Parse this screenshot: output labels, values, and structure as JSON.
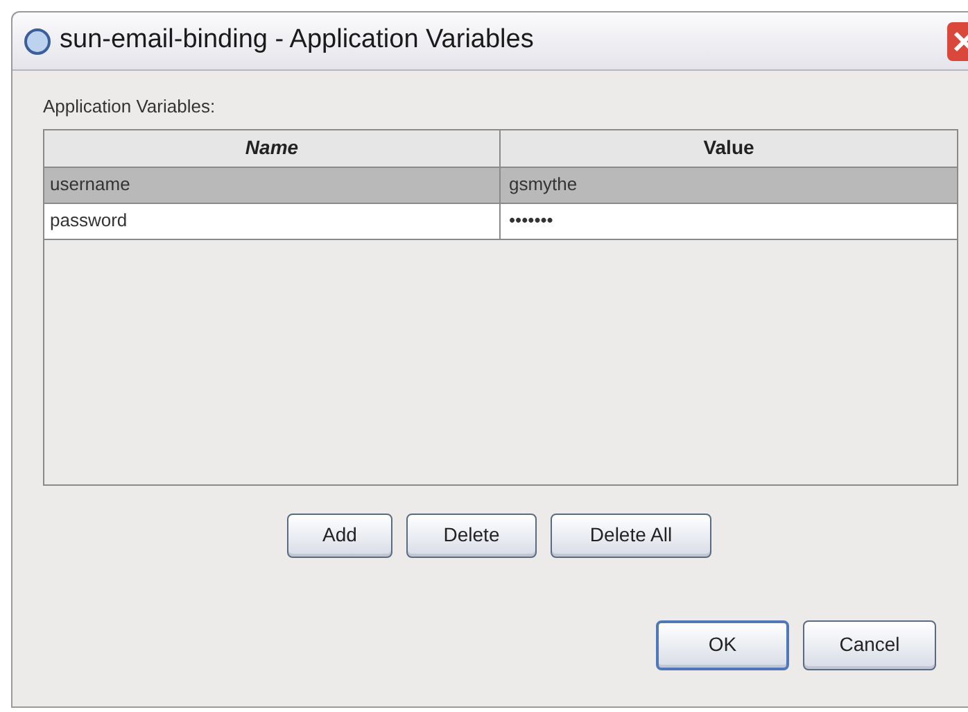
{
  "window": {
    "title": "sun-email-binding - Application Variables"
  },
  "label": "Application Variables:",
  "table": {
    "columns": [
      {
        "label": "Name",
        "italic": true
      },
      {
        "label": "Value",
        "italic": false
      }
    ],
    "rows": [
      {
        "name": "username",
        "value": "gsmythe",
        "selected": true
      },
      {
        "name": "password",
        "value": "•••••••",
        "selected": false
      }
    ]
  },
  "table_buttons": [
    "Add",
    "Delete",
    "Delete All"
  ],
  "dialog_buttons": [
    {
      "label": "OK",
      "default": true
    },
    {
      "label": "Cancel",
      "default": false
    }
  ]
}
